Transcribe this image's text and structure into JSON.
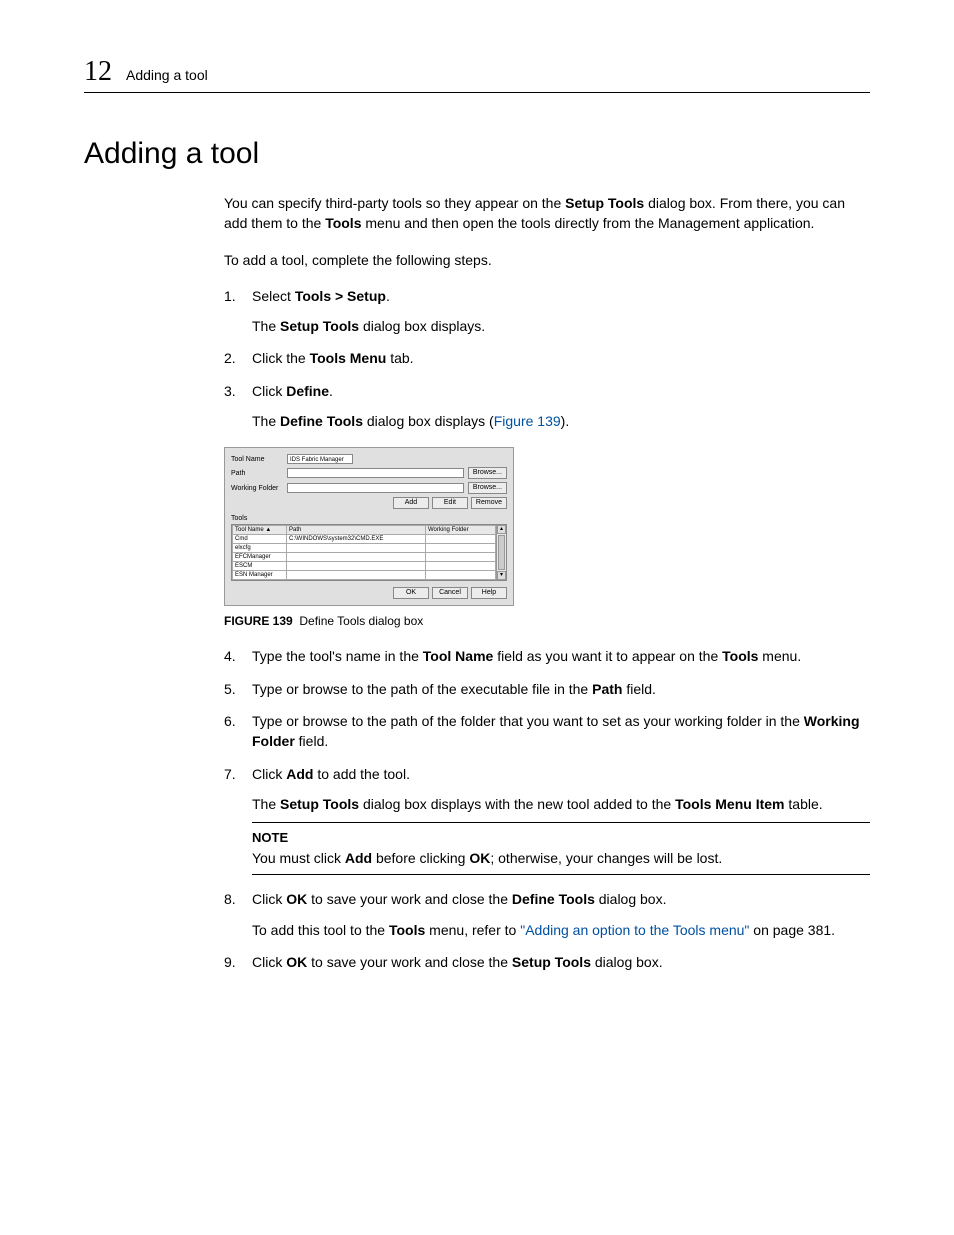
{
  "header": {
    "chapter_number": "12",
    "running_title": "Adding a tool"
  },
  "title": "Adding a tool",
  "intro": {
    "p1_a": "You can specify third-party tools so they appear on the ",
    "p1_b": "Setup Tools",
    "p1_c": " dialog box. From there, you can add them to the ",
    "p1_d": "Tools",
    "p1_e": " menu and then open the tools directly from the Management application.",
    "p2": "To add a tool, complete the following steps."
  },
  "steps": {
    "s1_a": "Select ",
    "s1_b": "Tools > Setup",
    "s1_c": ".",
    "s1_sub_a": "The ",
    "s1_sub_b": "Setup Tools",
    "s1_sub_c": " dialog box displays.",
    "s2_a": "Click the ",
    "s2_b": "Tools Menu",
    "s2_c": " tab.",
    "s3_a": "Click ",
    "s3_b": "Define",
    "s3_c": ".",
    "s3_sub_a": "The ",
    "s3_sub_b": "Define Tools",
    "s3_sub_c": " dialog box displays (",
    "s3_sub_link": "Figure 139",
    "s3_sub_d": ").",
    "s4_a": "Type the tool's name in the ",
    "s4_b": "Tool Name",
    "s4_c": " field as you want it to appear on the ",
    "s4_d": "Tools",
    "s4_e": " menu.",
    "s5_a": "Type or browse to the path of the executable file in the ",
    "s5_b": "Path",
    "s5_c": " field.",
    "s6_a": "Type or browse to the path of the folder that you want to set as your working folder in the ",
    "s6_b": "Working Folder",
    "s6_c": " field.",
    "s7_a": "Click ",
    "s7_b": "Add",
    "s7_c": " to add the tool.",
    "s7_sub_a": "The ",
    "s7_sub_b": "Setup Tools",
    "s7_sub_c": " dialog box displays with the new tool added to the ",
    "s7_sub_d": "Tools Menu Item",
    "s7_sub_e": " table.",
    "note_title": "NOTE",
    "note_a": "You must click ",
    "note_b": "Add",
    "note_c": " before clicking ",
    "note_d": "OK",
    "note_e": "; otherwise, your changes will be lost.",
    "s8_a": "Click ",
    "s8_b": "OK",
    "s8_c": " to save your work and close the ",
    "s8_d": "Define Tools",
    "s8_e": " dialog box.",
    "s8_sub_a": "To add this tool to the ",
    "s8_sub_b": "Tools",
    "s8_sub_c": " menu, refer to ",
    "s8_sub_link": "\"Adding an option to the Tools menu\"",
    "s8_sub_d": " on page 381.",
    "s9_a": "Click ",
    "s9_b": "OK",
    "s9_c": " to save your work and close the ",
    "s9_d": "Setup Tools",
    "s9_e": " dialog box."
  },
  "figure": {
    "label": "FIGURE 139",
    "caption": "Define Tools dialog box"
  },
  "dialog": {
    "labels": {
      "tool_name": "Tool Name",
      "path": "Path",
      "working_folder": "Working Folder",
      "tools": "Tools"
    },
    "inputs": {
      "tool_name_value": "IDS Fabric Manager",
      "path_value": "",
      "working_folder_value": ""
    },
    "buttons": {
      "browse": "Browse...",
      "add": "Add",
      "edit": "Edit",
      "remove": "Remove",
      "ok": "OK",
      "cancel": "Cancel",
      "help": "Help"
    },
    "table": {
      "headers": {
        "tool_name": "Tool Name ▲",
        "path": "Path",
        "working_folder": "Working Folder"
      },
      "rows": [
        {
          "name": "Cmd",
          "path": "C:\\WINDOWS\\system32\\CMD.EXE",
          "wf": ""
        },
        {
          "name": "elxcfg",
          "path": "",
          "wf": ""
        },
        {
          "name": "EFCManager",
          "path": "",
          "wf": ""
        },
        {
          "name": "ESCM",
          "path": "",
          "wf": ""
        },
        {
          "name": "ESN Manager",
          "path": "",
          "wf": ""
        }
      ]
    },
    "scroll": {
      "up": "▴",
      "down": "▾"
    }
  }
}
